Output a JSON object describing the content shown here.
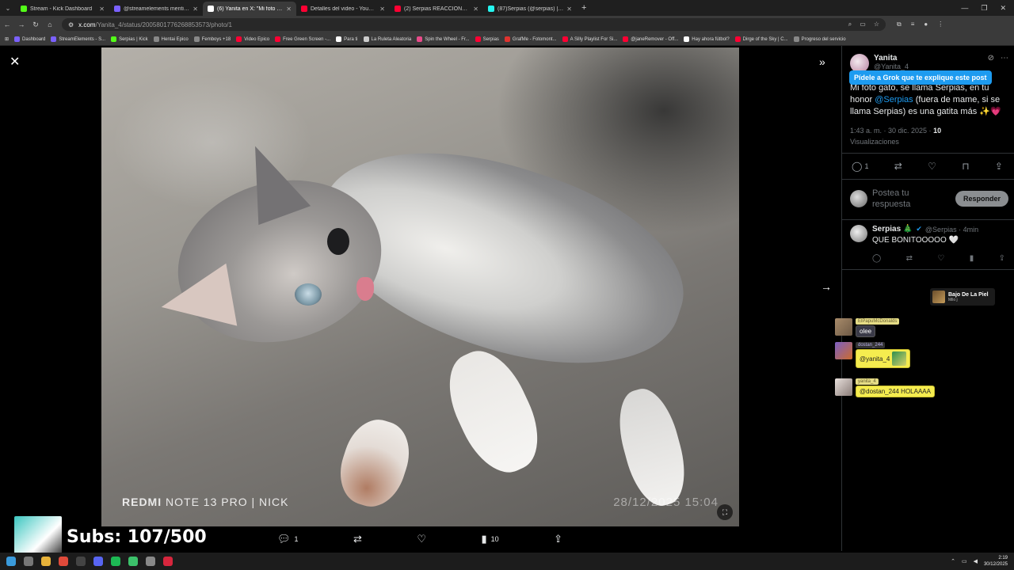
{
  "browser": {
    "tabs": [
      {
        "label": "Stream - Kick Dashboard",
        "color": "#53fc18"
      },
      {
        "label": "@streamelements mention",
        "color": "#7b61ff"
      },
      {
        "label": "(6) Yanita en X: \"Mi foto gato, s",
        "color": "#ffffff"
      },
      {
        "label": "Detalles del video - YouTube St",
        "color": "#ff0033"
      },
      {
        "label": "(2) Serpias REACCIONA a 1000",
        "color": "#ff0033"
      },
      {
        "label": "(87)Serpias (@serpias) | TikTok",
        "color": "#25f4ee"
      }
    ],
    "active_tab_index": 2,
    "url_host": "x.com",
    "url_path": "/Yanita_4/status/2005801776268853573/photo/1"
  },
  "bookmarks": [
    {
      "label": "Dashboard",
      "color": "#7b61ff"
    },
    {
      "label": "StreamElements - S...",
      "color": "#7b61ff"
    },
    {
      "label": "Serpias | Kick",
      "color": "#53fc18"
    },
    {
      "label": "Hentai Epico",
      "color": "#888888"
    },
    {
      "label": "Femboys +18",
      "color": "#888888"
    },
    {
      "label": "Video Epico",
      "color": "#ff0033"
    },
    {
      "label": "Free Green Screen -...",
      "color": "#ff0033"
    },
    {
      "label": "Para ti",
      "color": "#ffffff"
    },
    {
      "label": "La Ruleta Aleatoria",
      "color": "#cccccc"
    },
    {
      "label": "Spin the Wheel - Fr...",
      "color": "#e94b8a"
    },
    {
      "label": "Serpias",
      "color": "#ff0033"
    },
    {
      "label": "GrafMe - Fotomont...",
      "color": "#e0332f"
    },
    {
      "label": "A Silly Playlist For Si...",
      "color": "#ff0033"
    },
    {
      "label": "@janeRemover - Off...",
      "color": "#ff0033"
    },
    {
      "label": "Hay ahora fútbol?",
      "color": "#ffffff"
    },
    {
      "label": "Dirge of the Sky | C...",
      "color": "#ff0033"
    },
    {
      "label": "Progreso del servicio",
      "color": "#888888"
    }
  ],
  "photo": {
    "watermark_brand": "REDMI",
    "watermark_model": "NOTE 13 PRO | NICK",
    "watermark_date": "28/12/2025  15:04"
  },
  "viewer_actions": {
    "replies": "1",
    "views": "10"
  },
  "post": {
    "author_name": "Yanita",
    "author_handle": "@Yanita_4",
    "grok_tip": "Pídele a Grok que te explique este post",
    "text_before": "Mi foto gato, se llama Serpias, en tu honor ",
    "mention": "@Serpias",
    "text_after": " (fuera de mame, si se llama Serpias) es una gatita más ✨💗",
    "time": "1:43 a. m. · 30 dic. 2025 · ",
    "views_count": "10",
    "views_label": "Visualizaciones",
    "reply_count": "1",
    "reply_placeholder": "Postea tu respuesta",
    "reply_button": "Responder"
  },
  "reply": {
    "name": "Serpias 🎄",
    "handle": "@Serpias · 4min",
    "text": "QUE BONITOOOOO 🤍"
  },
  "now_playing": {
    "title": "Bajo De La Piel",
    "artist": "Milo j"
  },
  "chat": [
    {
      "user": "ElPapuMcDonalds",
      "message": "olee"
    },
    {
      "user": "dostan_244",
      "message": "@yanita_4"
    },
    {
      "user": "yanita_4",
      "message": "@dostan_244 HOLAAAA"
    }
  ],
  "subs": "Subs: 107/500",
  "clock": {
    "time": "2:19",
    "date": "30/12/2025"
  }
}
